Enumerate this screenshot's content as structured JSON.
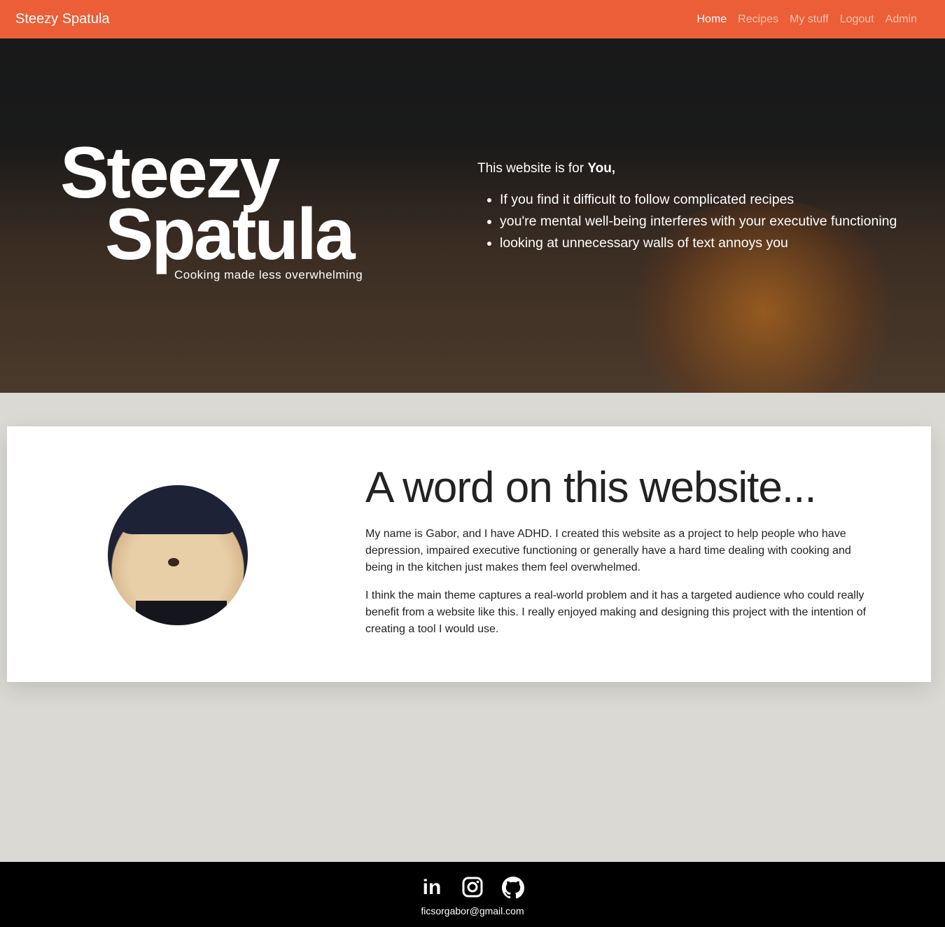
{
  "nav": {
    "brand": "Steezy Spatula",
    "links": [
      "Home",
      "Recipes",
      "My stuff",
      "Logout",
      "Admin"
    ],
    "active": "Home"
  },
  "hero": {
    "logo_line1": "Steezy",
    "logo_line2": "Spatula",
    "tagline": "Cooking made less overwhelming",
    "intro_prefix": "This website is for ",
    "intro_bold": "You,",
    "bullets": [
      "If you find it difficult to follow complicated recipes",
      "you're mental well-being interferes with your executive functioning",
      "looking at unnecessary walls of text annoys you"
    ]
  },
  "about": {
    "title": "A word on this website...",
    "p1": "My name is Gabor, and I have ADHD. I created this website as a project to help people who have depression, impaired executive functioning or generally have a hard time dealing with cooking and being in the kitchen just makes them feel overwhelmed.",
    "p2": "I think the main theme captures a real-world problem and it has a targeted audience who could really benefit from a website like this. I really enjoyed making and designing this project with the intention of creating a tool I would use."
  },
  "footer": {
    "icons": [
      "linkedin-icon",
      "instagram-icon",
      "github-icon"
    ],
    "linkedin_text": "in",
    "email": "ficsorgabor@gmail.com"
  },
  "colors": {
    "nav": "#eb5e37",
    "background": "#dad9d4",
    "footer": "#000000"
  }
}
